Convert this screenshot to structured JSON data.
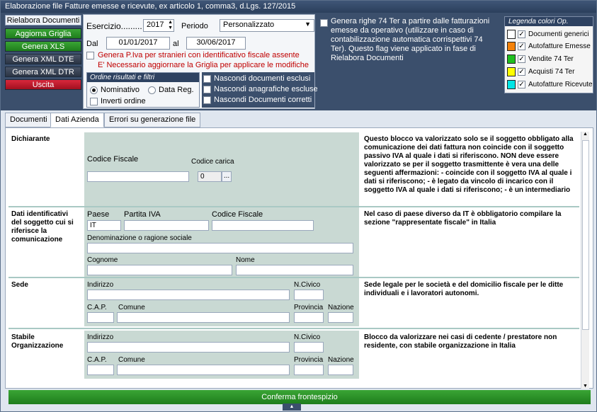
{
  "window": {
    "title": "Elaborazione file Fatture emesse e ricevute, ex articolo 1, comma3, d.Lgs. 127/2015"
  },
  "sidebar": {
    "buttons": [
      "Rielabora Documenti",
      "Aggiorna Griglia",
      "Genera XLS",
      "Genera XML DTE",
      "Genera XML DTR",
      "Uscita"
    ]
  },
  "period": {
    "esercizio_label": "Esercizio.........",
    "esercizio_value": "2017",
    "periodo_label": "Periodo",
    "periodo_value": "Personalizzato",
    "dal_label": "Dal",
    "dal_value": "01/01/2017",
    "al_label": "al",
    "al_value": "30/06/2017",
    "piva_label": "Genera P.Iva per stranieri con identificativo fiscale assente",
    "warning": "E' Necessario aggiornare la Griglia per applicare le modifiche"
  },
  "ordine": {
    "header": "Ordine risultati e filtri",
    "nominativo": "Nominativo",
    "data_reg": "Data Reg.",
    "inverti": "Inverti ordine"
  },
  "hide_options": [
    "Nascondi documenti esclusi",
    "Nascondi anagrafiche escluse",
    "Nascondi Documenti corretti"
  ],
  "genera_74ter": "Genera righe 74 Ter a partire dalle fatturazioni emesse da operativo (utilizzare in caso di contabilizzazione automatica corrispettivi 74 Ter). Questo flag viene applicato in fase di Rielabora Documenti",
  "legend": {
    "header": "Legenda colori Op.",
    "items": [
      {
        "label": "Documenti generici",
        "color": "#ffffff"
      },
      {
        "label": "Autofatture Emesse",
        "color": "#f5820a"
      },
      {
        "label": "Vendite 74 Ter",
        "color": "#1fbf1f"
      },
      {
        "label": "Acquisti 74 Ter",
        "color": "#ffff00"
      },
      {
        "label": "Autofatture Ricevute",
        "color": "#00e5e5"
      }
    ]
  },
  "tabs": [
    "Documenti",
    "Dati Azienda",
    "Errori su generazione file"
  ],
  "sections": {
    "dichiarante": {
      "label": "Dichiarante",
      "codice_fiscale": "Codice Fiscale",
      "codice_carica": "Codice carica",
      "codice_carica_value": "0",
      "note": "Questo blocco va valorizzato solo se il soggetto obbligato alla comunicazione dei dati fattura non coincide con il soggetto passivo IVA al quale i dati si riferiscono. NON deve essere valorizzato se per il soggetto trasmittente è vera una delle seguenti affermazioni: - coincide con il soggetto IVA al quale i dati si riferiscono; - è legato da vincolo di incarico con il soggetto IVA al quale i dati si riferiscono; - è un intermediario"
    },
    "dati_id": {
      "label": "Dati identificativi del soggetto cui si riferisce la comunicazione",
      "paese": "Paese",
      "paese_value": "IT",
      "partita_iva": "Partita IVA",
      "codice_fiscale": "Codice Fiscale",
      "denominazione": "Denominazione o ragione sociale",
      "cognome": "Cognome",
      "nome": "Nome",
      "note": "Nel caso di paese diverso da IT è obbligatorio compilare la sezione \"rappresentate fiscale\" in Italia"
    },
    "sede": {
      "label": "Sede",
      "indirizzo": "Indirizzo",
      "ncivico": "N.Civico",
      "cap": "C.A.P.",
      "comune": "Comune",
      "provincia": "Provincia",
      "nazione": "Nazione",
      "note": "Sede legale per le società e del domicilio fiscale per le ditte individuali e i lavoratori autonomi."
    },
    "stabile": {
      "label": "Stabile Organizzazione",
      "indirizzo": "Indirizzo",
      "ncivico": "N.Civico",
      "cap": "C.A.P.",
      "comune": "Comune",
      "provincia": "Provincia",
      "nazione": "Nazione",
      "note": "Blocco da valorizzare nei casi di cedente / prestatore non residente, con stabile organizzazione in Italia"
    }
  },
  "confirm_button": "Conferma frontespizio"
}
